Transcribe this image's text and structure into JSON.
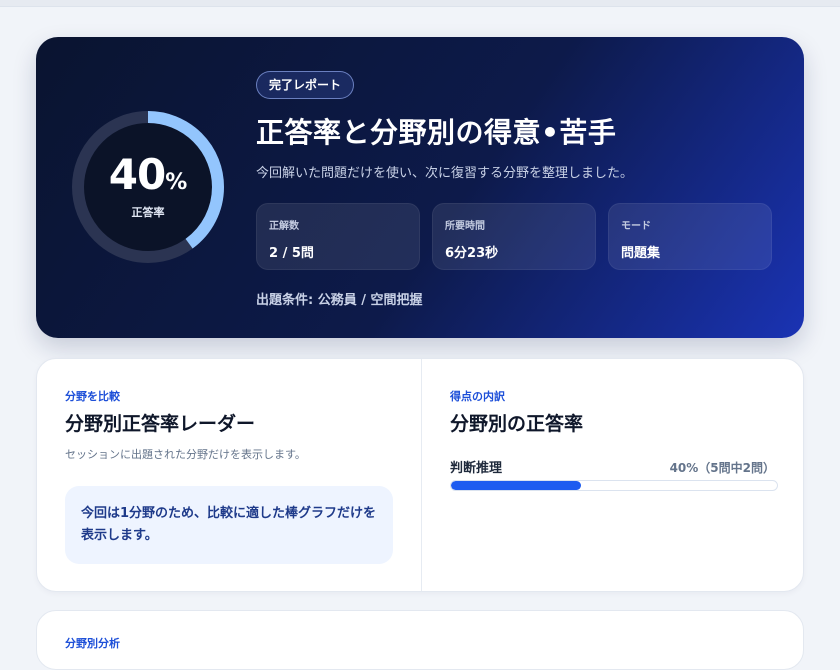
{
  "hero": {
    "score_value": "40",
    "score_unit": "%",
    "score_label": "正答率",
    "score_fraction": 0.4,
    "badge": "完了レポート",
    "title": "正答率と分野別の得意•苦手",
    "subtitle": "今回解いた問題だけを使い、次に復習する分野を整理しました。",
    "stats": [
      {
        "label": "正解数",
        "value": "2 / 5問"
      },
      {
        "label": "所要時間",
        "value": "6分23秒"
      },
      {
        "label": "モード",
        "value": "問題集"
      }
    ],
    "condition": "出題条件: 公務員 / 空間把握",
    "colors": {
      "ring_fill": "#93c5fd",
      "ring_track": "#2b3452"
    }
  },
  "radar": {
    "eyebrow": "分野を比較",
    "title": "分野別正答率レーダー",
    "description": "セッションに出題された分野だけを表示します。",
    "note": "今回は1分野のため、比較に適した棒グラフだけを表示します。"
  },
  "breakdown": {
    "eyebrow": "得点の内訳",
    "title": "分野別の正答率",
    "items": [
      {
        "name": "判断推理",
        "info": "40%（5問中2問）",
        "fraction": 0.4
      }
    ],
    "accent": "#1d5cf0"
  },
  "next_section": {
    "eyebrow": "分野別分析"
  }
}
